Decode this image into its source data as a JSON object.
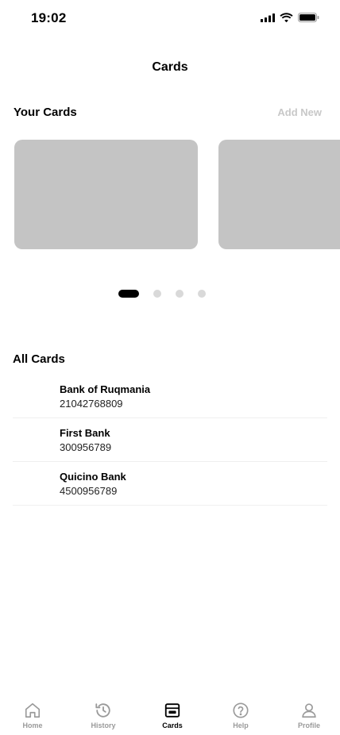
{
  "status_bar": {
    "time": "19:02",
    "icons": [
      "signal-icon",
      "wifi-icon",
      "battery-icon"
    ]
  },
  "header": {
    "title": "Cards"
  },
  "your_cards": {
    "title": "Your Cards",
    "add_new_label": "Add New",
    "carousel": {
      "page_count": 4,
      "active_page": 1
    }
  },
  "all_cards": {
    "title": "All Cards",
    "items": [
      {
        "bank": "Bank of Ruqmania",
        "number": "21042768809"
      },
      {
        "bank": "First Bank",
        "number": "300956789"
      },
      {
        "bank": "Quicino Bank",
        "number": "4500956789"
      }
    ]
  },
  "tab_bar": {
    "items": [
      {
        "label": "Home",
        "icon": "home-icon",
        "active": false
      },
      {
        "label": "History",
        "icon": "history-icon",
        "active": false
      },
      {
        "label": "Cards",
        "icon": "wallet-icon",
        "active": true
      },
      {
        "label": "Help",
        "icon": "help-icon",
        "active": false
      },
      {
        "label": "Profile",
        "icon": "profile-icon",
        "active": false
      }
    ]
  },
  "colors": {
    "accent": "#000000",
    "muted": "#9a9a9a",
    "placeholder": "#c4c4c4",
    "dot_inactive": "#d9d9d9"
  }
}
